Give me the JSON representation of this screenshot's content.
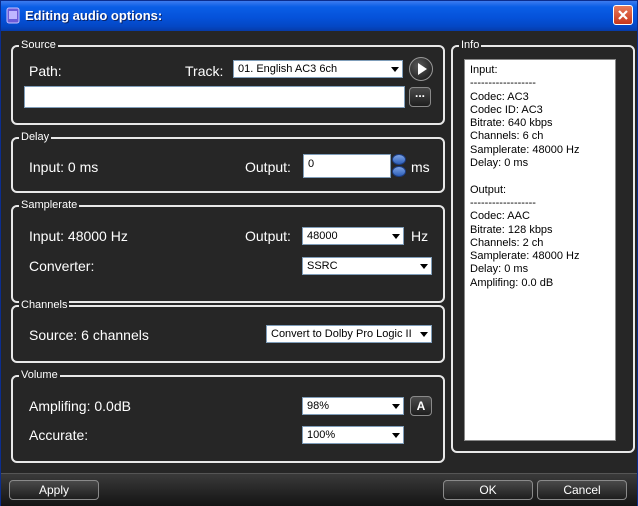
{
  "window": {
    "title": "Editing audio options:"
  },
  "source": {
    "legend": "Source",
    "path_label": "Path:",
    "path_value": "",
    "track_label": "Track:",
    "track_value": "01. English AC3 6ch",
    "browse_label": "..."
  },
  "delay": {
    "legend": "Delay",
    "input_label": "Input: 0 ms",
    "output_label": "Output:",
    "output_value": "0",
    "unit": "ms"
  },
  "samplerate": {
    "legend": "Samplerate",
    "input_label": "Input: 48000 Hz",
    "output_label": "Output:",
    "output_value": "48000",
    "unit": "Hz",
    "converter_label": "Converter:",
    "converter_value": "SSRC"
  },
  "channels": {
    "legend": "Channels",
    "source_label": "Source: 6 channels",
    "mode_value": "Convert to Dolby Pro Logic II"
  },
  "volume": {
    "legend": "Volume",
    "amplifing_label": "Amplifing: 0.0dB",
    "amplifing_value": "98%",
    "auto_label": "A",
    "accurate_label": "Accurate:",
    "accurate_value": "100%"
  },
  "info": {
    "legend": "Info",
    "text": "Input:\n------------------\nCodec: AC3\nCodec ID: AC3\nBitrate: 640 kbps\nChannels: 6 ch\nSamplerate: 48000 Hz\nDelay: 0 ms\n\nOutput:\n------------------\nCodec: AAC\nBitrate: 128 kbps\nChannels: 2 ch\nSamplerate: 48000 Hz\nDelay: 0 ms\nAmplifing: 0.0 dB"
  },
  "buttons": {
    "apply": "Apply",
    "ok": "OK",
    "cancel": "Cancel"
  }
}
